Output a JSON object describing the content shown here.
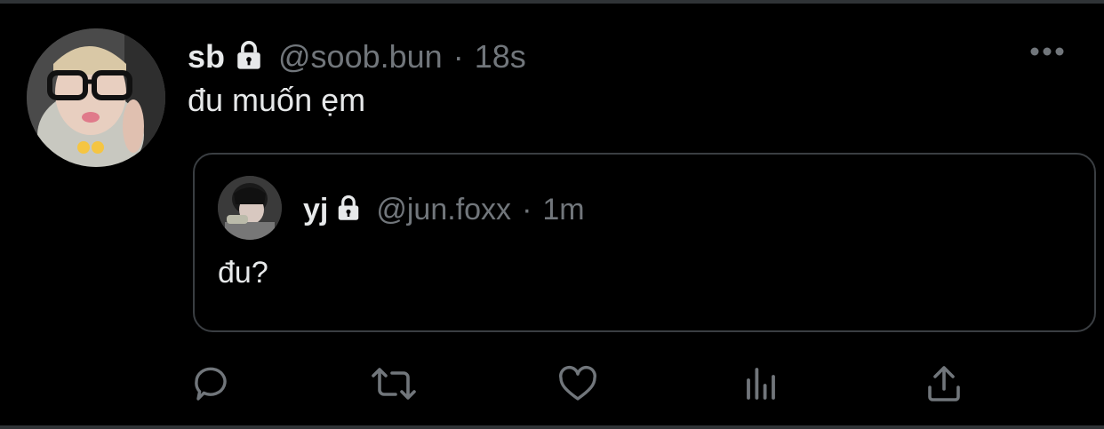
{
  "tweet": {
    "display_name": "sb",
    "handle": "@soob.bun",
    "separator": "·",
    "time": "18s",
    "text": "đu muốn ẹm",
    "avatar_icon": "user-avatar-photo",
    "lock_icon": "lock-icon",
    "more_icon": "more-options-icon"
  },
  "quote": {
    "display_name": "yj",
    "handle": "@jun.foxx",
    "separator": "·",
    "time": "1m",
    "text": "đu?",
    "avatar_icon": "user-avatar-photo",
    "lock_icon": "lock-icon"
  },
  "actions": [
    {
      "name": "reply",
      "icon": "reply-icon"
    },
    {
      "name": "retweet",
      "icon": "retweet-icon"
    },
    {
      "name": "like",
      "icon": "heart-icon"
    },
    {
      "name": "analytics",
      "icon": "analytics-icon"
    },
    {
      "name": "share",
      "icon": "share-icon"
    }
  ],
  "colors": {
    "background": "#000000",
    "primary_text": "#e7e9ea",
    "secondary_text": "#71767b",
    "border": "#2f3336"
  }
}
